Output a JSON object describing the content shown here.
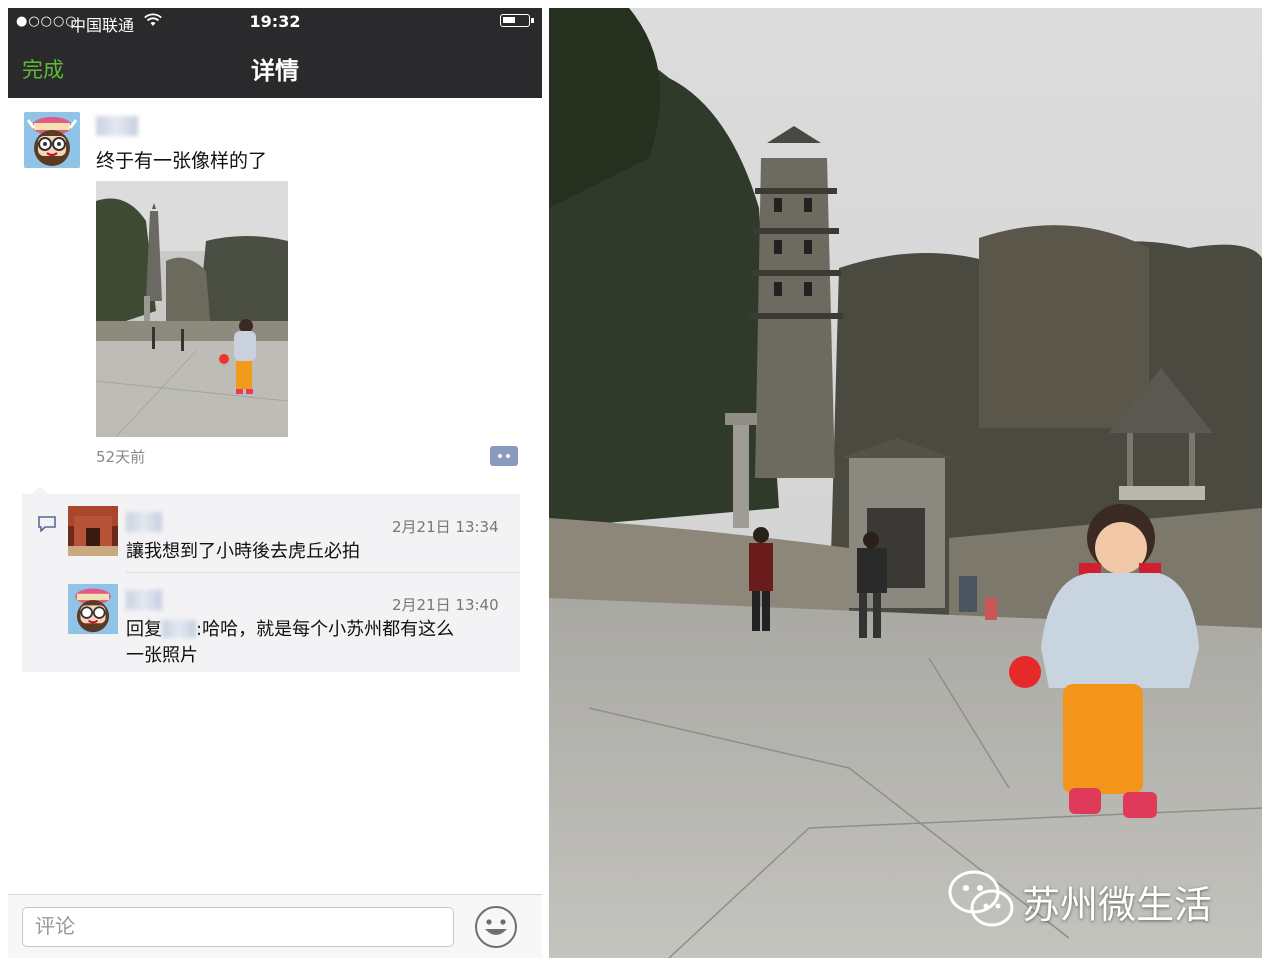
{
  "status_bar": {
    "signal": "●○○○○",
    "carrier": "中国联通",
    "time": "19:32",
    "icons": [
      "wifi-icon",
      "battery-icon"
    ]
  },
  "nav": {
    "done_label": "完成",
    "title": "详情"
  },
  "post": {
    "text": "终于有一张像样的了",
    "time_ago": "52天前",
    "photo_subject": "child-at-tiger-hill-pagoda"
  },
  "comments": [
    {
      "date": "2月21日 13:34",
      "text": "讓我想到了小時後去虎丘必拍"
    },
    {
      "date": "2月21日 13:40",
      "reply_prefix": "回复",
      "text_line1": ":哈哈，就是每个小苏州都有这么",
      "text_line2": "一张照片"
    }
  ],
  "input": {
    "placeholder": "评论"
  },
  "watermark": {
    "text": "苏州微生活",
    "icon": "wechat-logo-icon"
  },
  "colors": {
    "accent_green": "#5dbb35",
    "header_bg": "#2a2a2c",
    "comment_bg": "#f3f3f5",
    "time_link": "#576b95"
  }
}
